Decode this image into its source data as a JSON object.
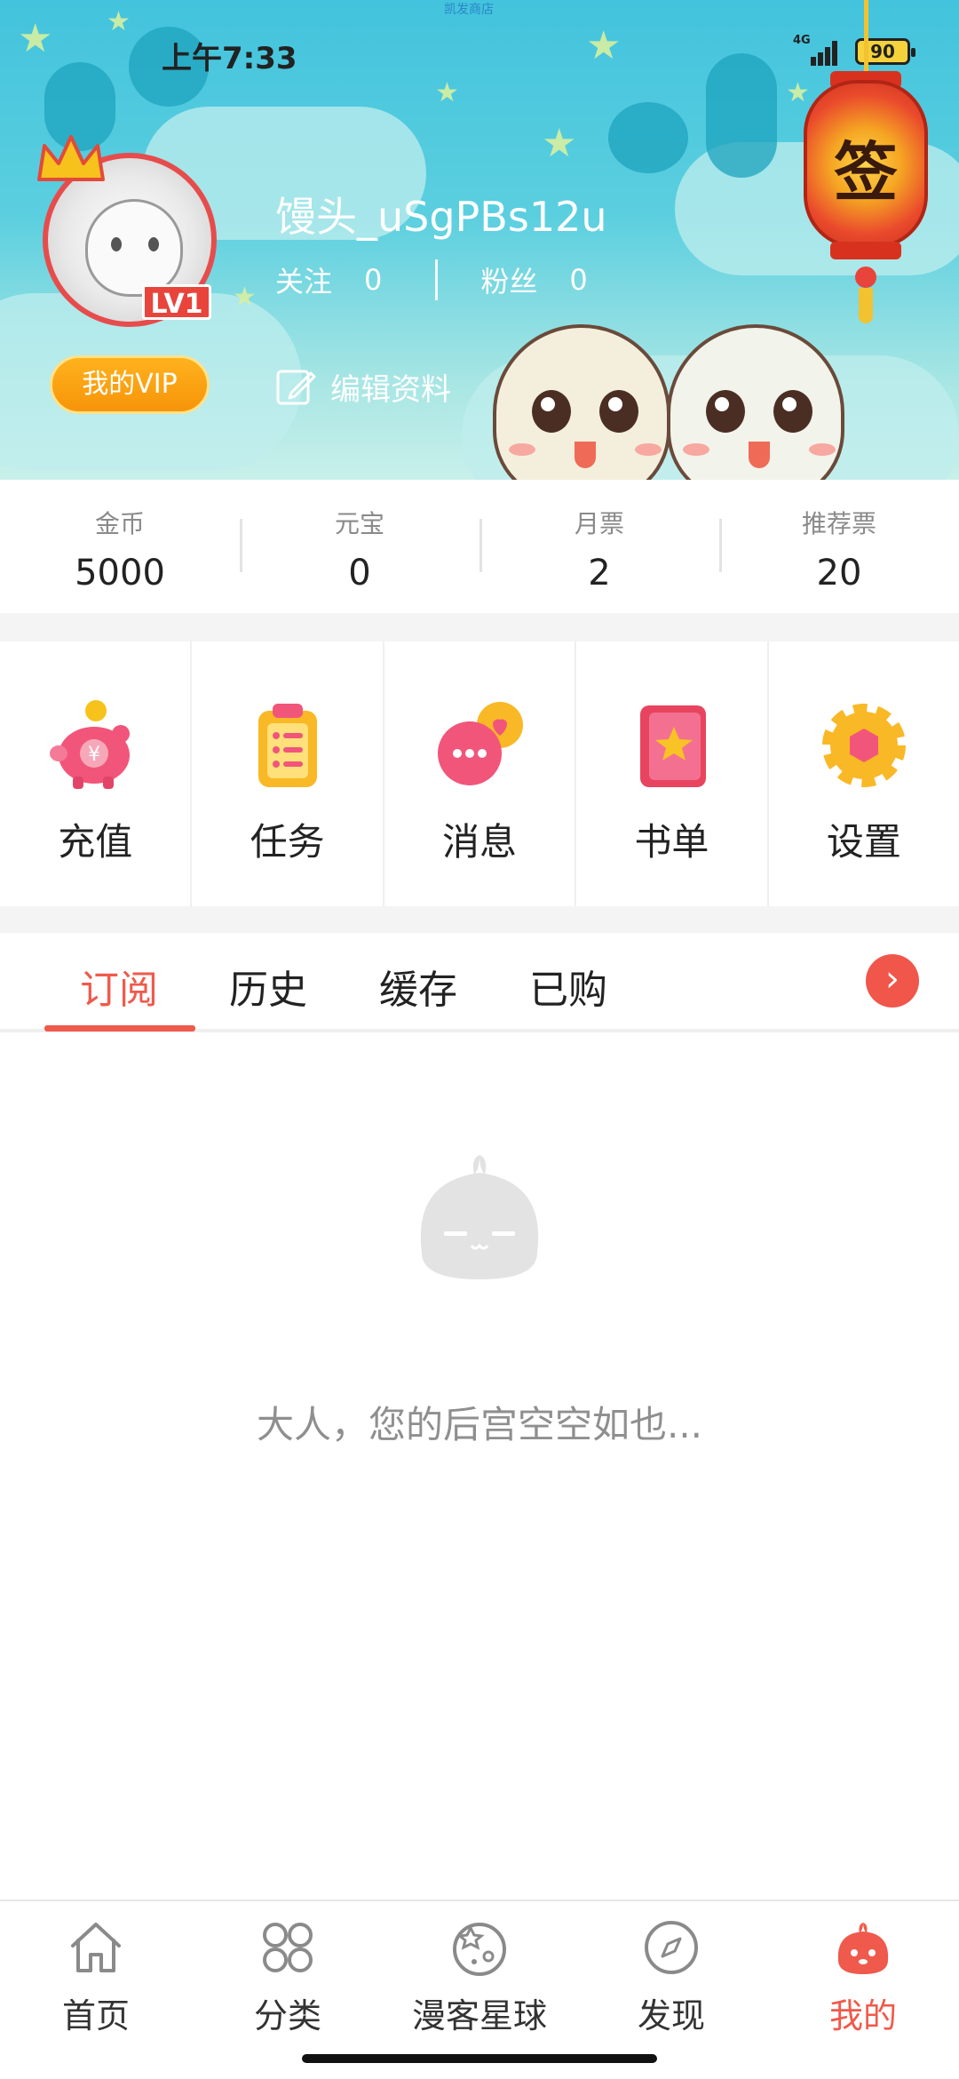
{
  "status_bar": {
    "time": "上午7:33",
    "top_text": "凯发商店",
    "network": "4G",
    "battery": "90"
  },
  "profile": {
    "username": "馒头_uSgPBs12u",
    "level": "LV1",
    "follow_label": "关注",
    "follow_count": "0",
    "fans_label": "粉丝",
    "fans_count": "0",
    "vip_label": "我的VIP",
    "edit_label": "编辑资料",
    "sign_char": "签"
  },
  "stats": [
    {
      "label": "金币",
      "value": "5000"
    },
    {
      "label": "元宝",
      "value": "0"
    },
    {
      "label": "月票",
      "value": "2"
    },
    {
      "label": "推荐票",
      "value": "20"
    }
  ],
  "menu": [
    {
      "label": "充值",
      "icon": "piggy-bank-icon"
    },
    {
      "label": "任务",
      "icon": "clipboard-icon"
    },
    {
      "label": "消息",
      "icon": "chat-bubble-icon"
    },
    {
      "label": "书单",
      "icon": "book-star-icon"
    },
    {
      "label": "设置",
      "icon": "gear-icon"
    }
  ],
  "tabs": [
    {
      "label": "订阅",
      "active": true
    },
    {
      "label": "历史",
      "active": false
    },
    {
      "label": "缓存",
      "active": false
    },
    {
      "label": "已购",
      "active": false
    }
  ],
  "empty_state": {
    "message": "大人，您的后宫空空如也..."
  },
  "bottom_nav": [
    {
      "label": "首页",
      "icon": "home-icon"
    },
    {
      "label": "分类",
      "icon": "grid-icon"
    },
    {
      "label": "漫客星球",
      "icon": "planet-icon"
    },
    {
      "label": "发现",
      "icon": "compass-icon"
    },
    {
      "label": "我的",
      "icon": "mascot-icon",
      "active": true
    }
  ],
  "colors": {
    "accent": "#ef5a4c",
    "header": "#43c3dd",
    "vip": "#f79409"
  }
}
